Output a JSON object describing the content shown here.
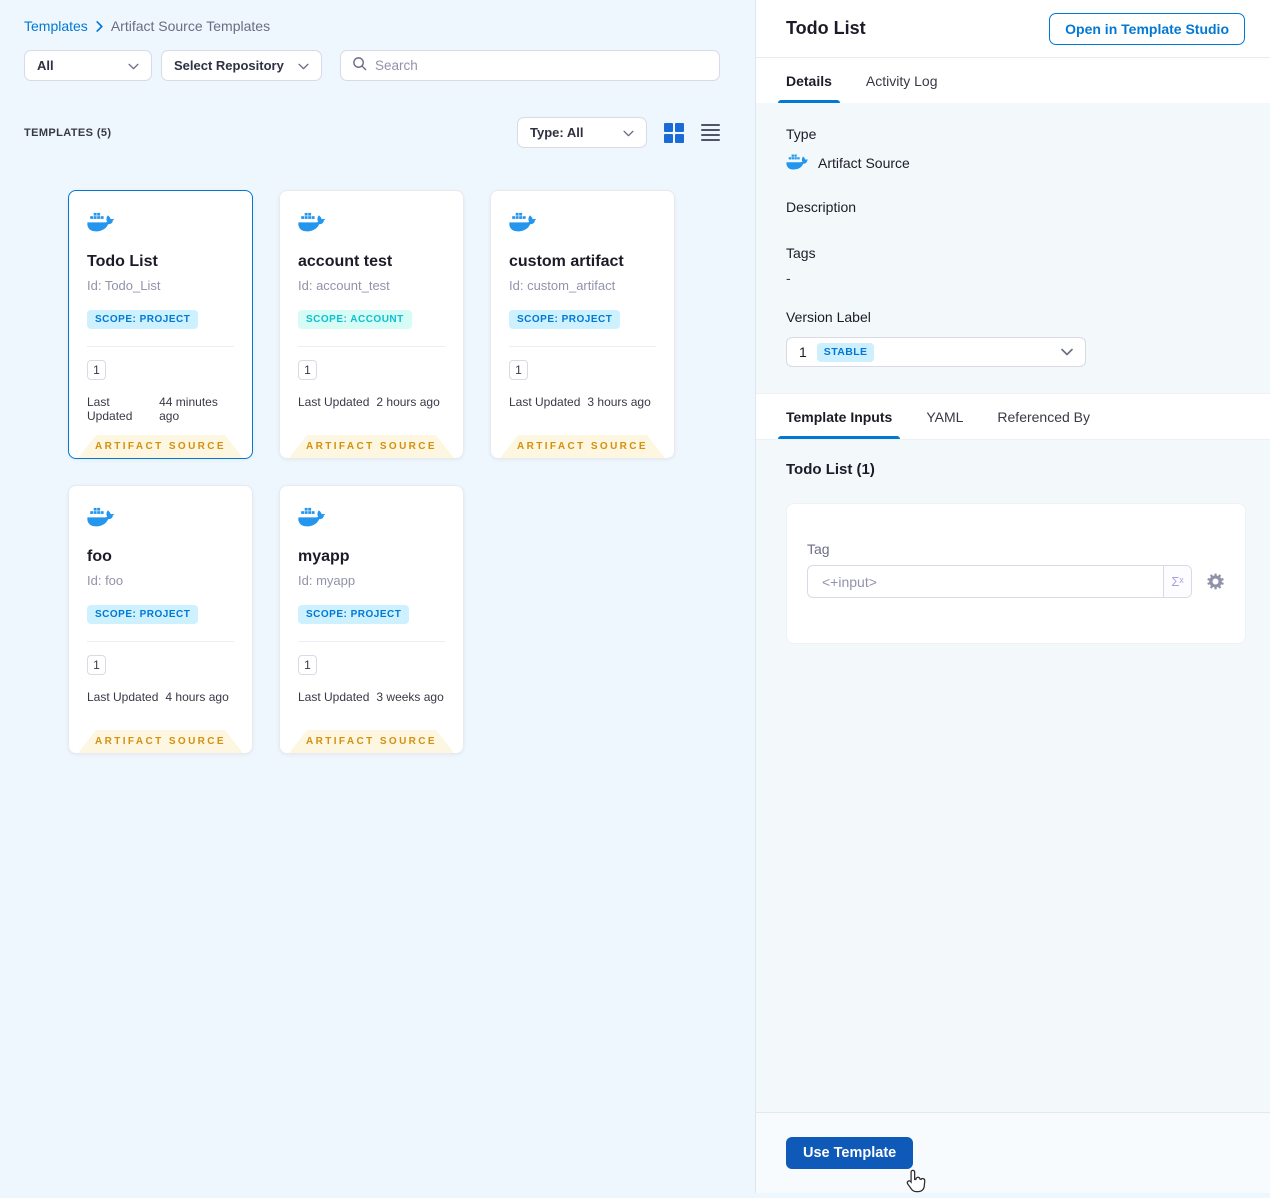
{
  "breadcrumb": {
    "link": "Templates",
    "current": "Artifact Source Templates"
  },
  "filters": {
    "scope_dropdown": "All",
    "repository_dropdown": "Select Repository",
    "search_placeholder": "Search"
  },
  "list_header": {
    "count_label": "TEMPLATES (5)",
    "type_dropdown": "Type: All"
  },
  "cards": [
    {
      "title": "Todo List",
      "id": "Id: Todo_List",
      "scope": "SCOPE: PROJECT",
      "scope_type": "project",
      "version": "1",
      "updated_label": "Last Updated",
      "updated": "44 minutes ago",
      "footer": "ARTIFACT SOURCE",
      "selected": true
    },
    {
      "title": "account test",
      "id": "Id: account_test",
      "scope": "SCOPE: ACCOUNT",
      "scope_type": "account",
      "version": "1",
      "updated_label": "Last Updated",
      "updated": "2 hours ago",
      "footer": "ARTIFACT SOURCE",
      "selected": false
    },
    {
      "title": "custom artifact",
      "id": "Id: custom_artifact",
      "scope": "SCOPE: PROJECT",
      "scope_type": "project",
      "version": "1",
      "updated_label": "Last Updated",
      "updated": "3 hours ago",
      "footer": "ARTIFACT SOURCE",
      "selected": false
    },
    {
      "title": "foo",
      "id": "Id: foo",
      "scope": "SCOPE: PROJECT",
      "scope_type": "project",
      "version": "1",
      "updated_label": "Last Updated",
      "updated": "4 hours ago",
      "footer": "ARTIFACT SOURCE",
      "selected": false
    },
    {
      "title": "myapp",
      "id": "Id: myapp",
      "scope": "SCOPE: PROJECT",
      "scope_type": "project",
      "version": "1",
      "updated_label": "Last Updated",
      "updated": "3 weeks ago",
      "footer": "ARTIFACT SOURCE",
      "selected": false
    }
  ],
  "details_panel": {
    "title": "Todo List",
    "open_studio_button": "Open in Template Studio",
    "tabs": [
      "Details",
      "Activity Log"
    ],
    "type_label": "Type",
    "type_value": "Artifact Source",
    "description_label": "Description",
    "tags_label": "Tags",
    "tags_value": "-",
    "version_label": "Version Label",
    "version_value": "1",
    "version_badge": "STABLE",
    "sub_tabs": [
      "Template Inputs",
      "YAML",
      "Referenced By"
    ],
    "inputs_title": "Todo List (1)",
    "tag_field_label": "Tag",
    "tag_field_value": "<+input>",
    "expression_button": "Σˣ",
    "use_template_button": "Use Template"
  },
  "icons": {
    "docker": "docker-whale",
    "search": "magnifier",
    "grid_view": "grid-2x2",
    "list_view": "hamburger-lines",
    "settings": "gear",
    "expression": "sigma-x",
    "cursor": "hand-pointer"
  },
  "colors": {
    "accent_blue": "#0278d5",
    "docker_blue": "#2496ed",
    "use_template_blue": "#0f59b9",
    "badge_project_bg": "#cdf1fe",
    "badge_account_bg": "#d6fcf5",
    "badge_account_text": "#0bc1cf",
    "stable_badge_bg": "#cdeffe",
    "ribbon_bg": "#fdf6e0",
    "ribbon_text": "#d4900e",
    "left_bg": "#eef7fd",
    "right_bg": "#f3f8fb"
  }
}
